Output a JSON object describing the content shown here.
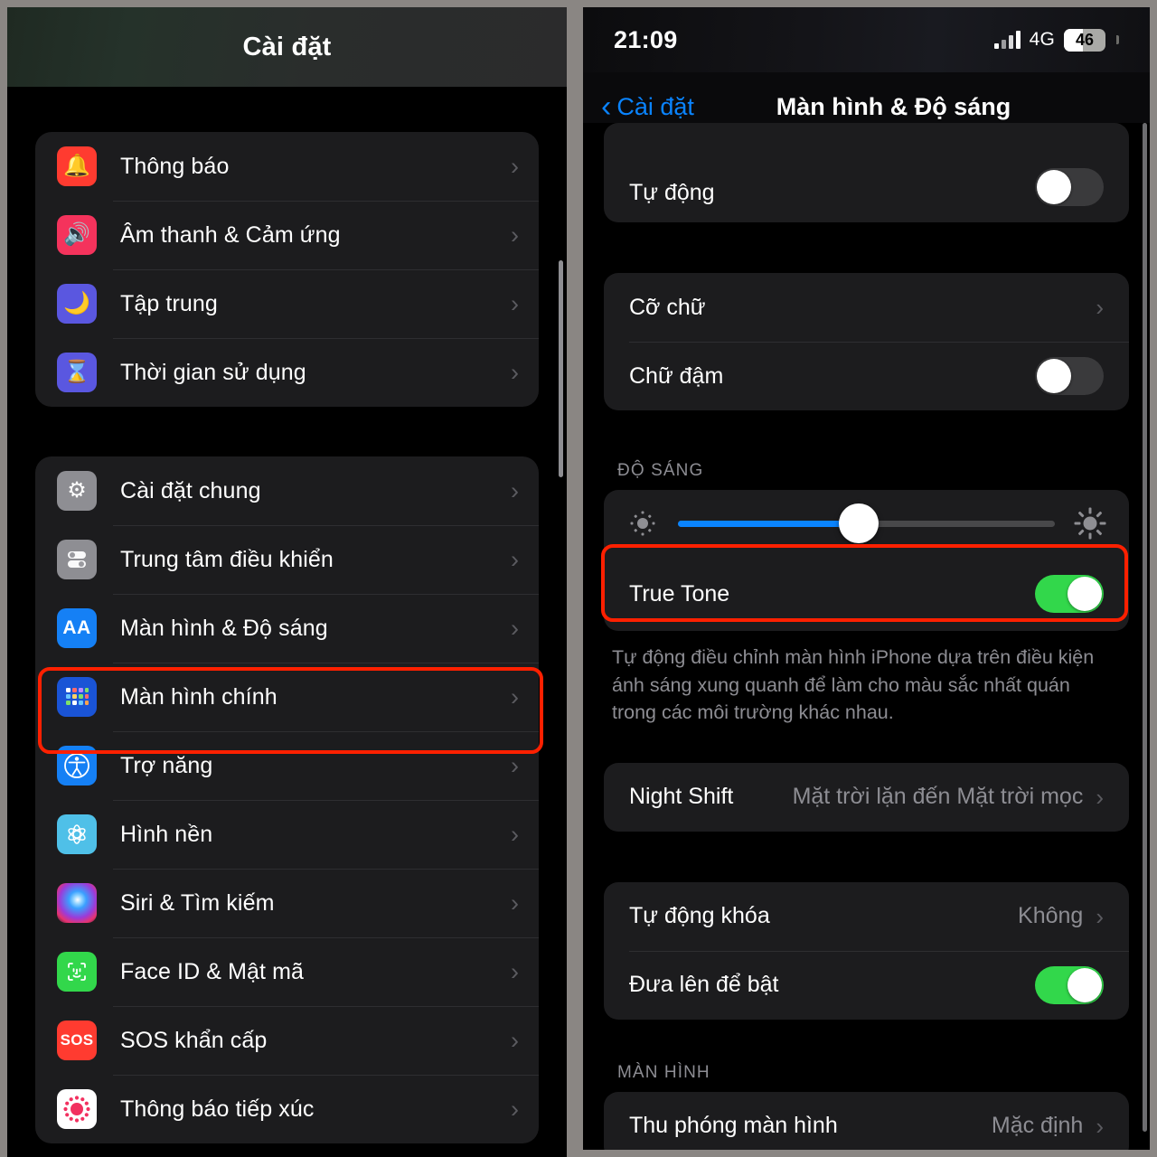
{
  "left_panel": {
    "nav_title": "Cài đặt",
    "groups": [
      {
        "items": [
          {
            "label": "Thông báo",
            "icon": "bell-icon"
          },
          {
            "label": "Âm thanh & Cảm ứng",
            "icon": "speaker-icon"
          },
          {
            "label": "Tập trung",
            "icon": "moon-icon"
          },
          {
            "label": "Thời gian sử dụng",
            "icon": "hourglass-icon"
          }
        ]
      },
      {
        "items": [
          {
            "label": "Cài đặt chung",
            "icon": "gear-icon"
          },
          {
            "label": "Trung tâm điều khiển",
            "icon": "control-center-icon"
          },
          {
            "label": "Màn hình & Độ sáng",
            "icon": "display-aa-icon",
            "highlighted": true
          },
          {
            "label": "Màn hình chính",
            "icon": "home-screen-icon"
          },
          {
            "label": "Trợ năng",
            "icon": "accessibility-icon"
          },
          {
            "label": "Hình nền",
            "icon": "wallpaper-icon"
          },
          {
            "label": "Siri & Tìm kiếm",
            "icon": "siri-icon"
          },
          {
            "label": "Face ID & Mật mã",
            "icon": "face-id-icon"
          },
          {
            "label": "SOS khẩn cấp",
            "icon": "sos-icon"
          },
          {
            "label": "Thông báo tiếp xúc",
            "icon": "exposure-notification-icon"
          }
        ]
      }
    ]
  },
  "right_panel": {
    "status_bar": {
      "time": "21:09",
      "network": "4G",
      "battery_percent": "46",
      "battery_level": 46,
      "signal_bars": 4
    },
    "nav": {
      "back_label": "Cài đặt",
      "title": "Màn hình & Độ sáng"
    },
    "group_auto": {
      "rows": [
        {
          "label": "Tự động",
          "toggle": "off"
        }
      ]
    },
    "group_text": {
      "rows": [
        {
          "label": "Cỡ chữ",
          "type": "chevron"
        },
        {
          "label": "Chữ đậm",
          "toggle": "off"
        }
      ]
    },
    "brightness": {
      "section_header": "ĐỘ SÁNG",
      "slider_value": 48,
      "low_icon": "brightness-low-icon",
      "high_icon": "brightness-high-icon",
      "true_tone": {
        "label": "True Tone",
        "toggle": "on",
        "highlighted": true
      },
      "footnote": "Tự động điều chỉnh màn hình iPhone dựa trên điều kiện ánh sáng xung quanh để làm cho màu sắc nhất quán trong các môi trường khác nhau."
    },
    "night_shift": {
      "label": "Night Shift",
      "value": "Mặt trời lặn đến Mặt trời mọc"
    },
    "lock_group": {
      "rows": [
        {
          "label": "Tự động khóa",
          "value": "Không",
          "type": "chevron"
        },
        {
          "label": "Đưa lên để bật",
          "toggle": "on"
        }
      ]
    },
    "display_section": {
      "section_header": "MÀN HÌNH",
      "rows": [
        {
          "label": "Thu phóng màn hình",
          "value": "Mặc định",
          "type": "chevron"
        }
      ]
    }
  },
  "accent_colors": {
    "highlight_red": "#ff2000",
    "ios_blue": "#0a84ff",
    "toggle_green": "#32d74b",
    "card_bg": "#1c1c1e",
    "secondary_text": "#8d8d93"
  }
}
